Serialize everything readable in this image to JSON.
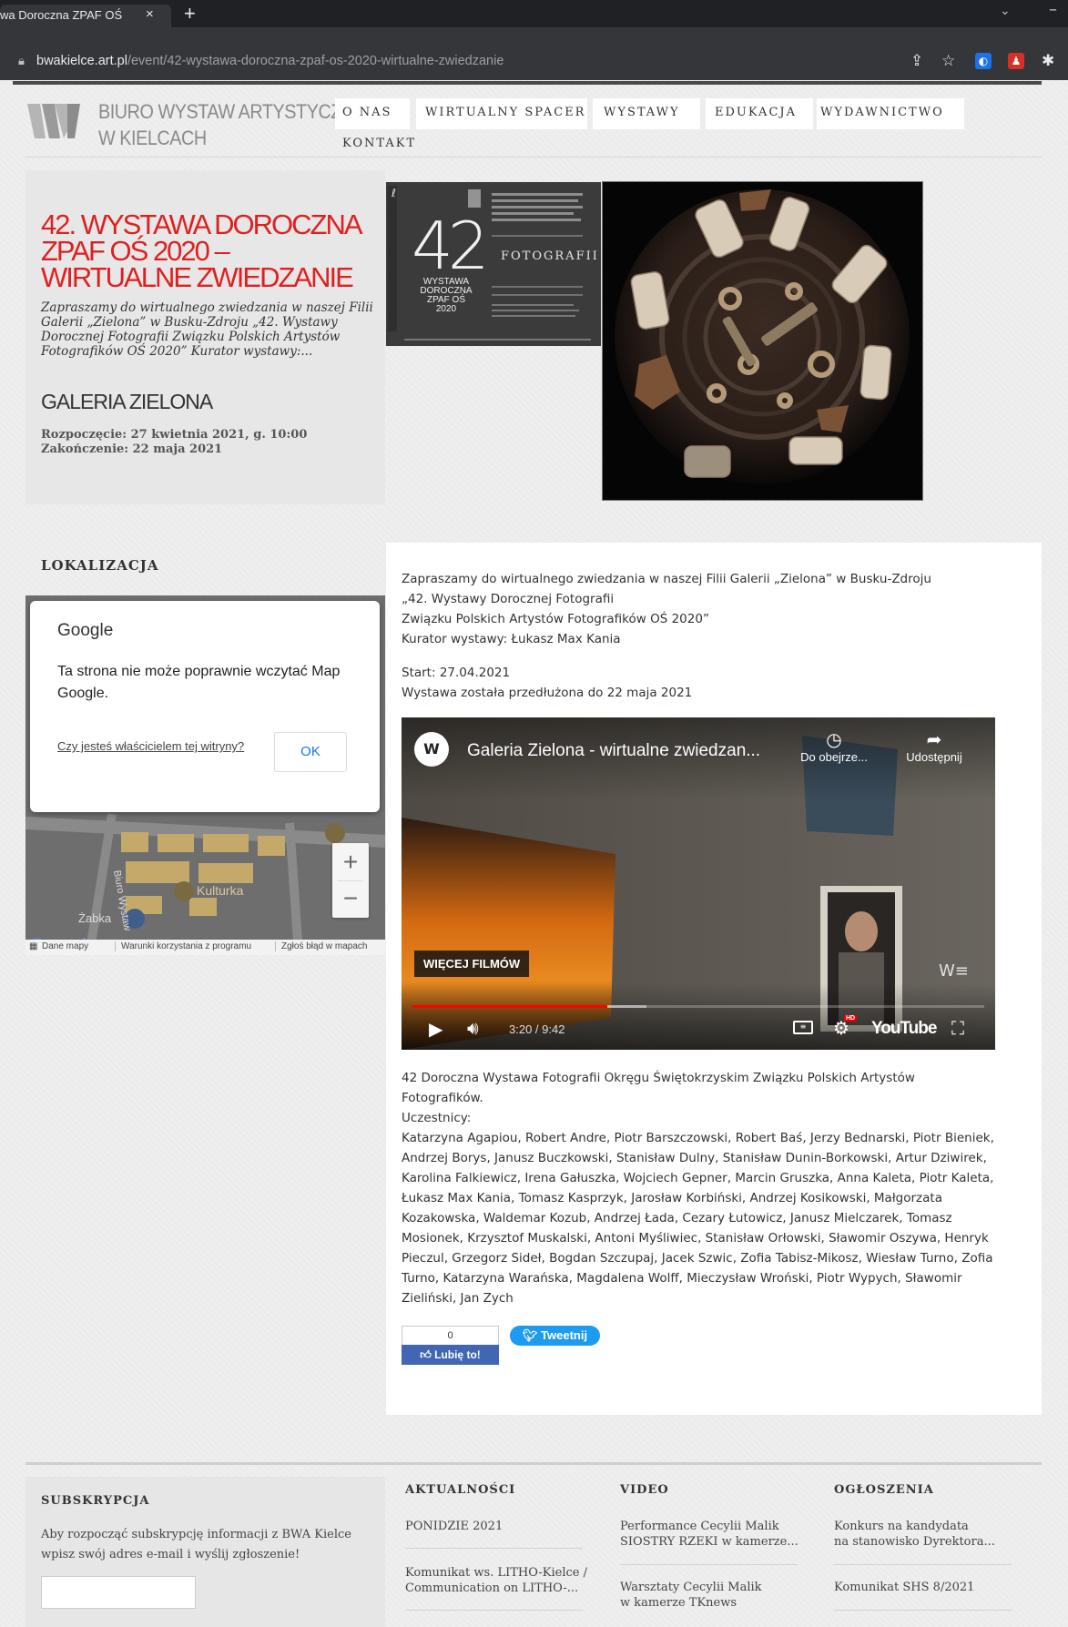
{
  "browser": {
    "tab_title": "wa Doroczna ZPAF OŚ",
    "tab_close": "×",
    "new_tab": "+",
    "url_host": "bwakielce.art.pl",
    "url_path": "/event/42-wystawa-doroczna-zpaf-os-2020-wirtualne-zwiedzanie"
  },
  "site": {
    "logo_line1": "BIURO WYSTAW ARTYSTYCZNYCH",
    "logo_line2": "W KIELCACH",
    "nav": [
      "O NAS",
      "WIRTUALNY SPACER",
      "WYSTAWY",
      "EDUKACJA",
      "WYDAWNICTWO",
      "KONTAKT"
    ]
  },
  "event": {
    "title": "42. WYSTAWA DOROCZNA ZPAF OŚ 2020 – WIRTUALNE ZWIEDZANIE",
    "description": "Zapraszamy do wirtualnego zwiedzania w naszej Filii Galerii „Zielona” w Busku-Zdroju „42. Wystawy Dorocznej Fotografii Związku Polskich Artystów Fotografików OŚ 2020” Kurator wystawy:...",
    "gallery": "GALERIA ZIELONA",
    "start": "Rozpoczęcie: 27 kwietnia 2021, g. 10:00",
    "end": "Zakończenie: 22 maja 2021",
    "poster": {
      "number": "42",
      "label_lines": [
        "WYSTAWA",
        "DOROCZNA",
        "ZPAF OŚ",
        "2020"
      ],
      "word": "FOTOGRAFII"
    }
  },
  "location": {
    "heading": "LOKALIZACJA",
    "dialog_brand": "Google",
    "dialog_message": "Ta strona nie może poprawnie wczytać Map Google.",
    "dialog_link": "Czy jesteś właścicielem tej witryny?",
    "dialog_ok": "OK",
    "zoom_in": "+",
    "zoom_out": "−",
    "poi_1": "Kulturka",
    "poi_2": "Żabka",
    "street_1": "Biuro Wystaw",
    "map_footer": [
      "Dane mapy",
      "Warunki korzystania z programu",
      "Zgłoś błąd w mapach"
    ]
  },
  "content": {
    "intro_lines": [
      "Zapraszamy do wirtualnego zwiedzania w naszej Filii Galerii „Zielona” w Busku-Zdroju",
      "„42. Wystawy Dorocznej Fotografii",
      "Związku Polskich Artystów Fotografików OŚ 2020”",
      "Kurator wystawy: Łukasz Max Kania"
    ],
    "start_line": "Start: 27.04.2021",
    "extended_line": "Wystawa została przedłużona do 22 maja 2021",
    "video": {
      "title": "Galeria Zielona - wirtualne zwiedzan...",
      "watch_later": "Do obejrze...",
      "share": "Udostępnij",
      "more_videos": "WIĘCEJ FILMÓW",
      "time": "3:20 / 9:42",
      "progress": 0.34,
      "buffered": 0.41,
      "youtube": "YouTube",
      "hd": "HD"
    },
    "summary_lines": [
      "42 Doroczna Wystawa Fotografii Okręgu Świętokrzyskim Związku Polskich Artystów",
      "Fotografików.",
      "Uczestnicy:"
    ],
    "participants_lines": [
      "Katarzyna Agapiou, Robert Andre, Piotr Barszczowski, Robert Baś, Jerzy Bednarski, Piotr Bieniek,",
      "Andrzej Borys, Janusz Buczkowski, Stanisław Dulny, Stanisław Dunin-Borkowski, Artur Dziwirek,",
      "Karolina Falkiewicz, Irena Gałuszka, Wojciech Gepner, Marcin Gruszka, Anna Kaleta, Piotr Kaleta,",
      "Łukasz Max Kania, Tomasz Kasprzyk, Jarosław Korbiński, Andrzej Kosikowski, Małgorzata",
      "Kozakowska, Waldemar Kozub, Andrzej Łada, Cezary Łutowicz, Janusz Mielczarek, Tomasz",
      "Mosionek, Krzysztof Muskalski, Antoni Myśliwiec, Stanisław Orłowski, Sławomir Oszywa, Henryk",
      "Pieczul, Grzegorz Sideł, Bogdan Szczupaj, Jacek Szwic, Zofia Tabisz-Mikosz, Wiesław Turno, Zofia",
      "Turno, Katarzyna Warańska, Magdalena Wolff, Mieczysław Wroński, Piotr Wypych, Sławomir",
      "Zieliński, Jan Zych"
    ],
    "like_count": "0",
    "like_label": "Lubię to!",
    "tweet_label": "Tweetnij"
  },
  "footer": {
    "subscription_heading": "SUBSKRYPCJA",
    "subscription_text_lines": [
      "Aby rozpocząć subskrypcję informacji z BWA Kielce",
      "wpisz swój adres e-mail i wyślij zgłoszenie!"
    ],
    "email_placeholder": "",
    "news_heading": "AKTUALNOŚCI",
    "news": [
      [
        "PONIDZIE 2021"
      ],
      [
        "Komunikat ws. LITHO-Kielce /",
        "Communication on LITHO-..."
      ]
    ],
    "video_heading": "VIDEO",
    "videos": [
      [
        "Performance Cecylii Malik",
        "SIOSTRY RZEKI w kamerze..."
      ],
      [
        "Warsztaty Cecylii Malik",
        "w kamerze TKnews"
      ]
    ],
    "ads_heading": "OGŁOSZENIA",
    "ads": [
      [
        "Konkurs na kandydata",
        "na stanowisko Dyrektora..."
      ],
      [
        "Komunikat SHS 8/2021"
      ]
    ]
  }
}
